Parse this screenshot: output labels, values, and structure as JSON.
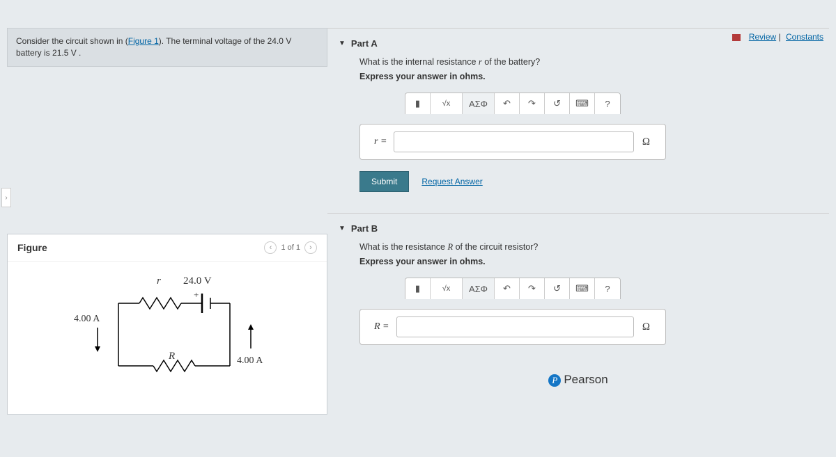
{
  "topLinks": {
    "review": "Review",
    "constants": "Constants"
  },
  "problem": {
    "prefix": "Consider the circuit shown in (",
    "figlink": "Figure 1",
    "suffix": "). The terminal voltage of the 24.0 V battery is 21.5 V ."
  },
  "figure": {
    "title": "Figure",
    "nav": "1 of 1",
    "emf": "24.0 V",
    "r_label": "r",
    "R_label": "R",
    "I_left": "4.00 A",
    "I_right": "4.00 A",
    "plus": "+"
  },
  "partA": {
    "title": "Part A",
    "question_pre": "What is the internal resistance ",
    "question_var": "r",
    "question_post": " of the battery?",
    "instruction": "Express your answer in ohms.",
    "var": "r =",
    "unit": "Ω",
    "placeholder": ""
  },
  "partB": {
    "title": "Part B",
    "question_pre": "What is the resistance ",
    "question_var": "R",
    "question_post": " of the circuit resistor?",
    "instruction": "Express your answer in ohms.",
    "var": "R =",
    "unit": "Ω",
    "placeholder": ""
  },
  "toolbar": {
    "tpl": "▮",
    "sqrt": "√x",
    "greek": "ΑΣΦ",
    "undo": "↶",
    "redo": "↷",
    "reset": "↺",
    "keyboard": "⌨",
    "help": "?"
  },
  "actions": {
    "submit": "Submit",
    "request": "Request Answer"
  },
  "brand": "Pearson",
  "expand": "›"
}
